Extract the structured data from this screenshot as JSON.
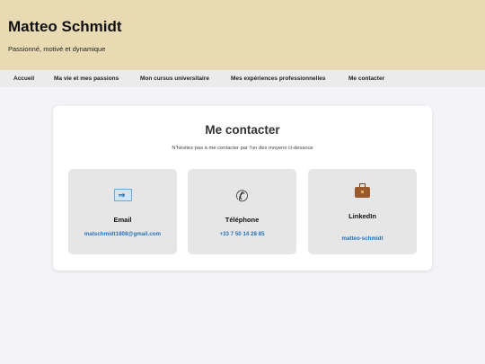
{
  "header": {
    "name": "Matteo Schmidt",
    "tagline": "Passionné, motivé et dynamique"
  },
  "nav": {
    "items": [
      {
        "label": "Accueil"
      },
      {
        "label": "Ma vie et mes passions"
      },
      {
        "label": "Mon cursus universitaire"
      },
      {
        "label": "Mes expériences professionnelles"
      },
      {
        "label": "Me contacter"
      }
    ]
  },
  "contact": {
    "title": "Me contacter",
    "subtitle": "N'hésitez pas à me contacter par l'un des moyens ci-dessous",
    "methods": [
      {
        "icon": "email-icon",
        "label": "Email",
        "value": "matschmidt1808@gmail.com"
      },
      {
        "icon": "phone-icon",
        "label": "Téléphone",
        "value": "+33 7 50 14 28 85"
      },
      {
        "icon": "briefcase-icon",
        "label": "LinkedIn",
        "value": "matteo-schmidt"
      }
    ]
  },
  "colors": {
    "header_bg": "#e8dab3",
    "nav_bg": "#ebebeb",
    "link": "#2a73b8",
    "box_bg": "#e6e6e6"
  }
}
